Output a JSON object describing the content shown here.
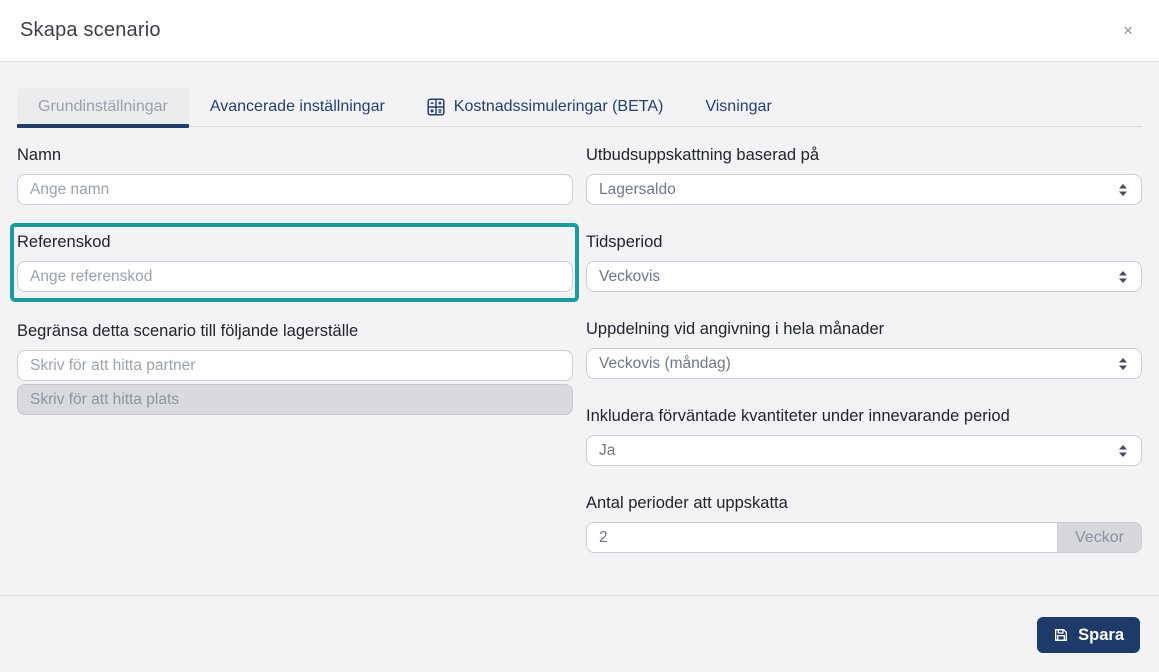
{
  "modal": {
    "title": "Skapa scenario",
    "close_glyph": "×"
  },
  "tabs": [
    {
      "label": "Grundinställningar",
      "active": true
    },
    {
      "label": "Avancerade inställningar",
      "active": false
    },
    {
      "label": "Kostnadssimuleringar (BETA)",
      "active": false,
      "icon": "calculator-icon"
    },
    {
      "label": "Visningar",
      "active": false
    }
  ],
  "form": {
    "namn": {
      "label": "Namn",
      "placeholder": "Ange namn",
      "value": ""
    },
    "referenskod": {
      "label": "Referenskod",
      "placeholder": "Ange referenskod",
      "value": "",
      "highlighted": true
    },
    "lagerstalle": {
      "label": "Begränsa detta scenario till följande lagerställe",
      "partner_placeholder": "Skriv för att hitta partner",
      "plats_placeholder": "Skriv för att hitta plats",
      "plats_disabled": true
    },
    "utbud": {
      "label": "Utbudsuppskattning baserad på",
      "value": "Lagersaldo"
    },
    "tidsperiod": {
      "label": "Tidsperiod",
      "value": "Veckovis"
    },
    "uppdelning": {
      "label": "Uppdelning vid angivning i hela månader",
      "value": "Veckovis (måndag)"
    },
    "inkludera": {
      "label": "Inkludera förväntade kvantiteter under innevarande period",
      "value": "Ja"
    },
    "antal_perioder": {
      "label": "Antal perioder att uppskatta",
      "value": "2",
      "unit": "Veckor"
    }
  },
  "footer": {
    "save_label": "Spara"
  },
  "colors": {
    "highlight_teal": "#1b9b9d",
    "accent_navy": "#1d3a69",
    "tab_text_navy": "#24406f",
    "body_background": "#f3f3f5",
    "disabled_gray": "#d9dadd"
  },
  "icons": {
    "tab3": "calculator-icon",
    "save": "floppy-disk-icon",
    "close": "close-icon",
    "selects": "up-down-arrows-icon"
  }
}
